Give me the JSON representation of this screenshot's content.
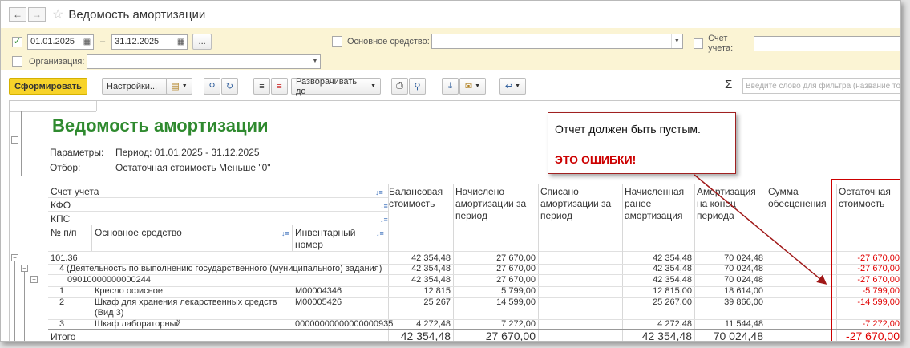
{
  "window": {
    "title": "Ведомость амортизации"
  },
  "filters": {
    "date_from": "01.01.2025",
    "date_sep": "–",
    "date_to": "31.12.2025",
    "more_btn": "...",
    "asset_label": "Основное средство:",
    "account_label": "Счет учета:",
    "org_label": "Организация:"
  },
  "toolbar": {
    "generate": "Сформировать",
    "settings": "Настройки...",
    "expand": "Разворачивать до",
    "sigma": "Σ",
    "filter_placeholder": "Введите слово для фильтра (название то"
  },
  "report": {
    "title": "Ведомость амортизации",
    "params_label": "Параметры:",
    "params_value": "Период: 01.01.2025 - 31.12.2025",
    "filter_label": "Отбор:",
    "filter_value": "Остаточная стоимость Меньше \"0\"",
    "headers": {
      "account": "Счет учета",
      "kfo": "КФО",
      "kps": "КПС",
      "num": "№ п/п",
      "asset": "Основное средство",
      "inv": "Инвентарный номер",
      "balance": "Балансовая стоимость",
      "accrued": "Начислено амортизации за период",
      "written_off": "Списано амортизации за период",
      "prior": "Начисленная ранее амортизация",
      "end": "Амортизация на конец периода",
      "impair": "Сумма обесценения",
      "residual": "Остаточная стоимость"
    },
    "rows": [
      {
        "label": "101.36",
        "inv": "",
        "balance": "42 354,48",
        "accrued": "27 670,00",
        "prior": "42 354,48",
        "end": "70 024,48",
        "residual": "-27 670,00"
      },
      {
        "label": "4 (Деятельность по выполнению государственного (муниципального) задания)",
        "inv": "",
        "balance": "42 354,48",
        "accrued": "27 670,00",
        "prior": "42 354,48",
        "end": "70 024,48",
        "residual": "-27 670,00"
      },
      {
        "label": "09010000000000244",
        "inv": "",
        "balance": "42 354,48",
        "accrued": "27 670,00",
        "prior": "42 354,48",
        "end": "70 024,48",
        "residual": "-27 670,00"
      },
      {
        "num": "1",
        "label": "Кресло офисное",
        "inv": "M00004346",
        "balance": "12 815",
        "accrued": "5 799,00",
        "prior": "12 815,00",
        "end": "18 614,00",
        "residual": "-5 799,00"
      },
      {
        "num": "2",
        "label": "Шкаф для хранения лекарственных средств (Вид 3)",
        "inv": "M00005426",
        "balance": "25 267",
        "accrued": "14 599,00",
        "prior": "25 267,00",
        "end": "39 866,00",
        "residual": "-14 599,00"
      },
      {
        "num": "3",
        "label": "Шкаф лабораторный",
        "inv": "00000000000000000935",
        "balance": "4 272,48",
        "accrued": "7 272,00",
        "prior": "4 272,48",
        "end": "11 544,48",
        "residual": "-7 272,00"
      }
    ],
    "total": {
      "label": "Итого",
      "balance": "42 354,48",
      "accrued": "27 670,00",
      "prior": "42 354,48",
      "end": "70 024,48",
      "residual": "-27 670,00"
    }
  },
  "callout": {
    "line1": "Отчет должен быть пустым.",
    "line2": "ЭТО ОШИБКИ!"
  }
}
